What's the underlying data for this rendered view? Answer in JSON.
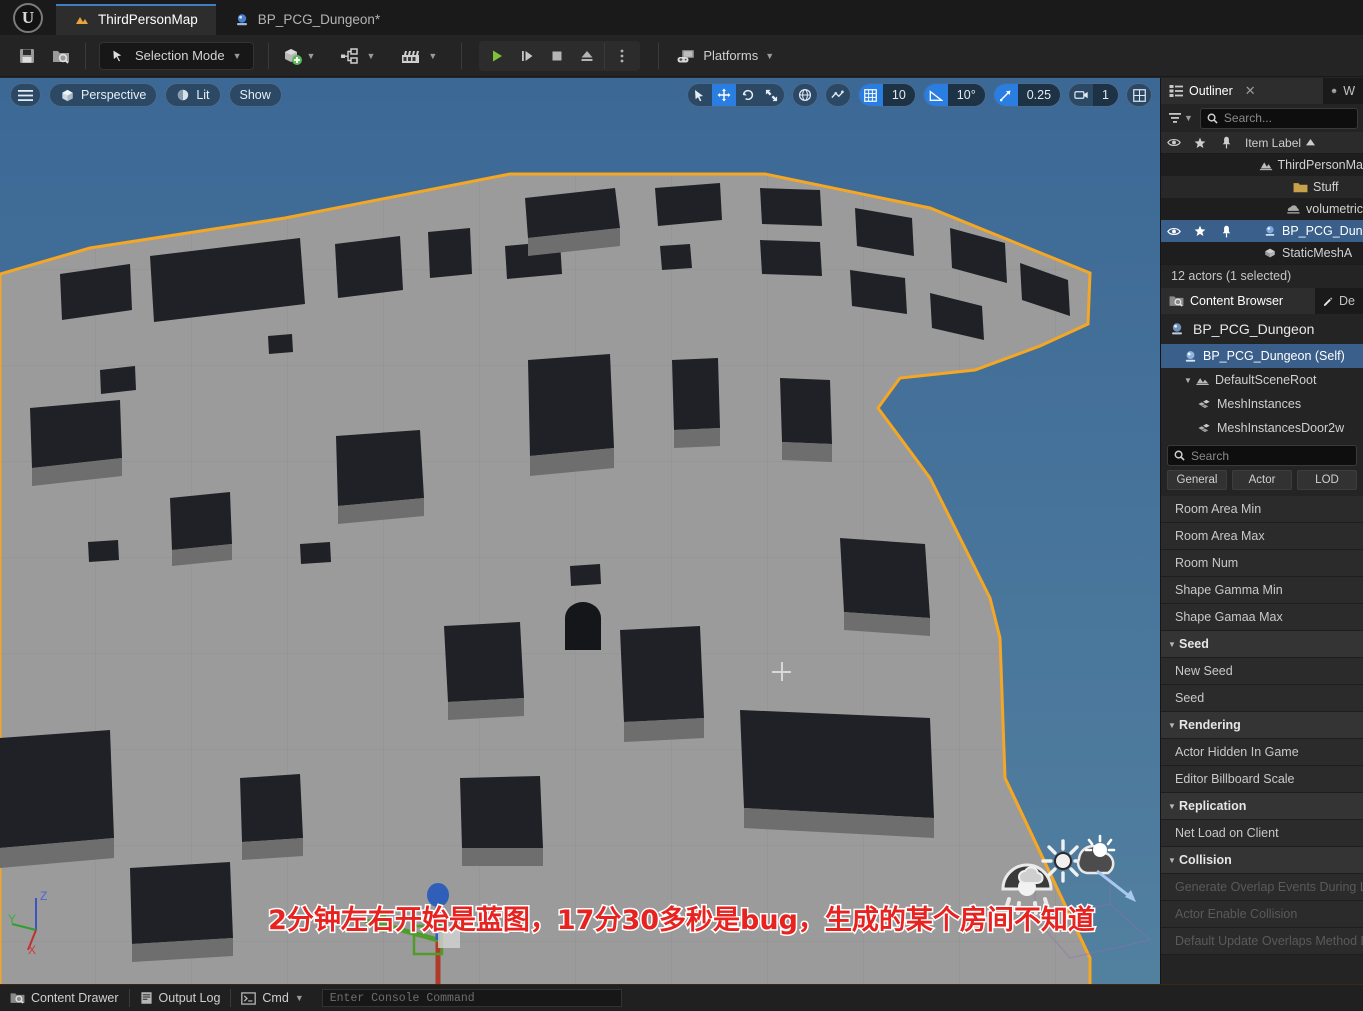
{
  "window": {
    "logo": "unreal-engine-logo",
    "tabs": [
      {
        "label": "ThirdPersonMap",
        "icon": "level-icon",
        "active": true
      },
      {
        "label": "BP_PCG_Dungeon*",
        "icon": "blueprint-icon",
        "active": false
      }
    ]
  },
  "toolbar": {
    "save_icon": "save-icon",
    "browse_icon": "browse-content-icon",
    "mode_label": "Selection Mode",
    "create_icon": "add-actor-icon",
    "blueprints_icon": "blueprints-icon",
    "cinematics_icon": "cinematics-icon",
    "play_icon": "play-icon",
    "skipplay_icon": "play-frame-icon",
    "stop_icon": "stop-icon",
    "eject_icon": "eject-icon",
    "more_icon": "more-options-icon",
    "platforms_label": "Platforms",
    "platforms_icon": "platforms-icon"
  },
  "viewport": {
    "menu_icon": "viewport-menu-icon",
    "perspective_label": "Perspective",
    "perspective_icon": "camera-cube-icon",
    "lit_label": "Lit",
    "lit_icon": "lighting-icon",
    "show_label": "Show",
    "tools": {
      "select_icon": "select-arrow-icon",
      "move_icon": "move-gizmo-icon",
      "rotate_icon": "rotate-gizmo-icon",
      "scale_icon": "scale-gizmo-icon",
      "world_icon": "world-coords-icon",
      "surface_snap_icon": "surface-snap-icon",
      "grid_snap_icon": "grid-snap-icon",
      "grid_snap_value": "10",
      "angle_snap_icon": "angle-snap-icon",
      "angle_snap_value": "10°",
      "scale_snap_icon": "scale-snap-icon",
      "scale_snap_value": "0.25",
      "camera_speed_icon": "camera-speed-icon",
      "camera_speed_value": "1",
      "maximize_icon": "maximize-viewport-icon"
    },
    "gizmo": {
      "transform": "translate-gizmo",
      "axis_x": "X",
      "axis_y": "Y",
      "axis_z": "Z"
    },
    "actor_icons": [
      "sky-light-icon",
      "directional-light-icon",
      "sky-atmosphere-icon"
    ],
    "crosshair": "viewport-crosshair"
  },
  "outliner": {
    "tab_label": "Outliner",
    "tab_icon": "outliner-icon",
    "close_icon": "close-icon",
    "neighbor_tab_label": "W",
    "neighbor_tab_icon": "world-settings-icon",
    "filter_icon": "filter-icon",
    "search_placeholder": "Search...",
    "search_icon": "search-icon",
    "columns": {
      "visibility_icon": "eye-icon",
      "favorite_icon": "star-icon",
      "pin_icon": "pin-icon",
      "label": "Item Label",
      "sort_icon": "sort-ascending-icon"
    },
    "rows": [
      {
        "label": "ThirdPersonMa",
        "icon": "level-icon",
        "indent": 3,
        "selected": false,
        "shade": "dark"
      },
      {
        "label": "Stuff",
        "icon": "folder-icon",
        "indent": 4,
        "selected": false,
        "shade": "alt"
      },
      {
        "label": "volumetric",
        "icon": "fog-icon",
        "indent": 5,
        "selected": false,
        "shade": "dark"
      },
      {
        "label": "BP_PCG_Dun",
        "icon": "blueprint-icon",
        "indent": 5,
        "selected": true,
        "shade": "sel"
      },
      {
        "label": "StaticMeshA",
        "icon": "staticmesh-icon",
        "indent": 5,
        "selected": false,
        "shade": "dark"
      }
    ],
    "status": "12 actors (1 selected)"
  },
  "details": {
    "tabs": [
      {
        "label": "Content Browser",
        "icon": "content-browser-icon",
        "active": true
      },
      {
        "label": "De",
        "icon": "details-pencil-icon",
        "active": false
      }
    ],
    "blueprint_title": "BP_PCG_Dungeon",
    "blueprint_icon": "blueprint-icon",
    "components": [
      {
        "label": "BP_PCG_Dungeon (Self)",
        "icon": "blueprint-icon",
        "indent": 0,
        "selected": true,
        "expander": ""
      },
      {
        "label": "DefaultSceneRoot",
        "icon": "scene-root-icon",
        "indent": 1,
        "selected": false,
        "expander": "▼"
      },
      {
        "label": "MeshInstances",
        "icon": "instanced-mesh-icon",
        "indent": 2,
        "selected": false,
        "expander": ""
      },
      {
        "label": "MeshInstancesDoor2w",
        "icon": "instanced-mesh-icon",
        "indent": 2,
        "selected": false,
        "expander": ""
      }
    ],
    "search_placeholder": "Search",
    "search_icon": "search-icon",
    "filter_tabs": [
      "General",
      "Actor",
      "LOD"
    ],
    "properties": [
      {
        "label": "Room Area Min",
        "category": false
      },
      {
        "label": "Room Area Max",
        "category": false
      },
      {
        "label": "Room Num",
        "category": false
      },
      {
        "label": "Shape Gamma Min",
        "category": false
      },
      {
        "label": "Shape Gamaa Max",
        "category": false
      },
      {
        "label": "Seed",
        "category": true
      },
      {
        "label": "New Seed",
        "category": false
      },
      {
        "label": "Seed",
        "category": false
      },
      {
        "label": "Rendering",
        "category": true
      },
      {
        "label": "Actor Hidden In Game",
        "category": false
      },
      {
        "label": "Editor Billboard Scale",
        "category": false
      },
      {
        "label": "Replication",
        "category": true
      },
      {
        "label": "Net Load on Client",
        "category": false
      },
      {
        "label": "Collision",
        "category": true
      },
      {
        "label": "Generate Overlap Events During Level Streaming",
        "category": false,
        "faded": true
      },
      {
        "label": "Actor Enable Collision",
        "category": false,
        "faded": true
      },
      {
        "label": "Default Update Overlaps Method Dur",
        "category": false,
        "faded": true
      }
    ]
  },
  "statusbar": {
    "content_drawer_label": "Content Drawer",
    "content_drawer_icon": "content-drawer-icon",
    "output_log_label": "Output Log",
    "output_log_icon": "output-log-icon",
    "cmd_label": "Cmd",
    "cmd_icon": "console-icon",
    "console_placeholder": "Enter Console Command"
  },
  "subtitle": {
    "text": "2分钟左右开始是蓝图，17分30多秒是bug，生成的某个房间不知道"
  },
  "colors": {
    "accent_blue": "#2a7de1",
    "selection_orange": "#f5a623",
    "selection_row": "#3a5f8a",
    "sky": "#46739f",
    "floor": "#9a9a9a",
    "subtitle_red": "#e8221f"
  }
}
